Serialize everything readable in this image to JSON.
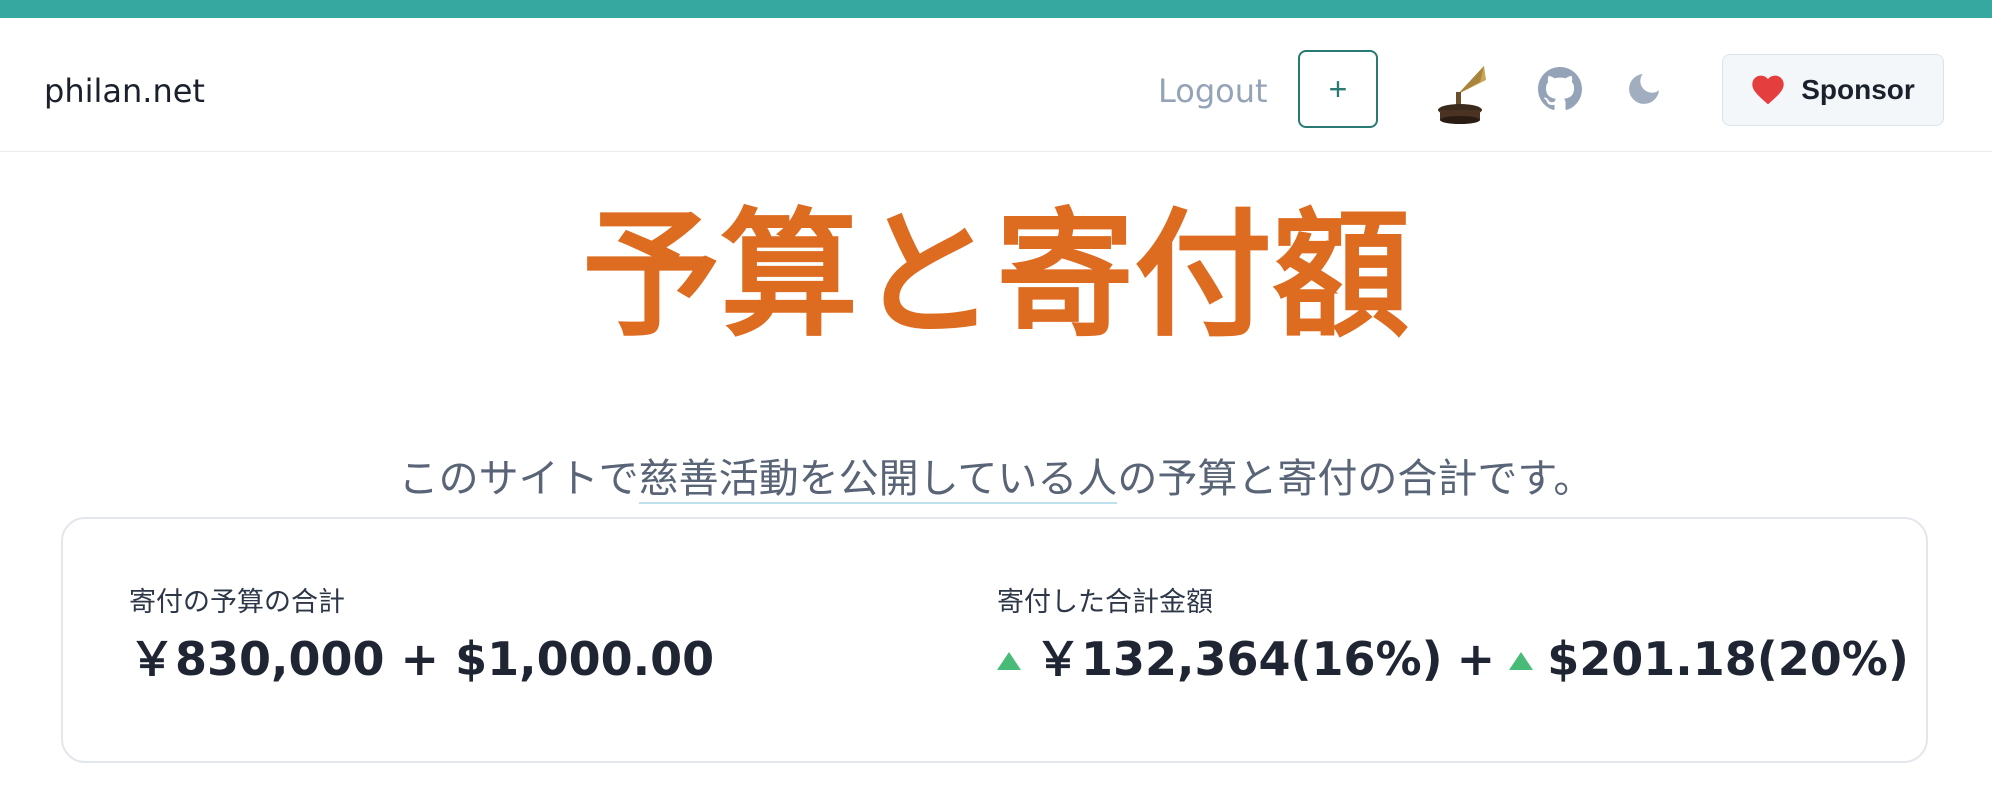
{
  "header": {
    "site_name": "philan.net",
    "logout_label": "Logout",
    "add_label": "+",
    "sponsor_label": "Sponsor",
    "icons": [
      "gramophone-icon",
      "github-icon",
      "moon-icon",
      "heart-icon"
    ]
  },
  "main": {
    "title": "予算と寄付額",
    "subtitle_before": "このサイトで",
    "subtitle_link": "慈善活動を公開している人",
    "subtitle_after": "の予算と寄付の合計です。"
  },
  "stats": {
    "budget": {
      "label": "寄付の予算の合計",
      "value": "￥830,000 + $1,000.00"
    },
    "donated": {
      "label": "寄付した合計金額",
      "jpy": "￥132,364(16%)",
      "plus": "+",
      "usd": "$201.18(20%)"
    }
  },
  "colors": {
    "accent": "#37a89f",
    "title": "#dd6b20",
    "increase": "#48bb78",
    "heart": "#e53e3e"
  }
}
